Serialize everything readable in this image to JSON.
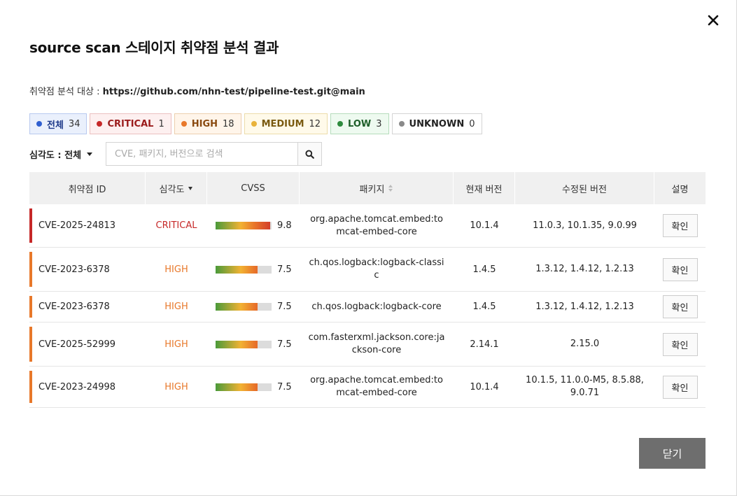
{
  "dialog": {
    "title": "source scan 스테이지 취약점 분석 결과",
    "target_label": "취약점 분석 대상 : ",
    "target_value": "https://github.com/nhn-test/pipeline-test.git@main",
    "close_icon": "close-icon",
    "dismiss_label": "닫기"
  },
  "filters": [
    {
      "label": "전체",
      "count": "34",
      "dot": "#2f5fd0",
      "text": "#1e3a8a",
      "bg": "#eaf0fc",
      "border": "#b8c9ef"
    },
    {
      "label": "CRITICAL",
      "count": "1",
      "dot": "#c62828",
      "text": "#9b1c1c",
      "bg": "#fdf0f0",
      "border": "#ebc0c0"
    },
    {
      "label": "HIGH",
      "count": "18",
      "dot": "#e8782a",
      "text": "#8a4a10",
      "bg": "#fff5ea",
      "border": "#eccfae"
    },
    {
      "label": "MEDIUM",
      "count": "12",
      "dot": "#e8b23a",
      "text": "#7a5a10",
      "bg": "#fffaea",
      "border": "#ecdcaa"
    },
    {
      "label": "LOW",
      "count": "3",
      "dot": "#2e8b3e",
      "text": "#1f5f2a",
      "bg": "#eefaf0",
      "border": "#b6dcbc"
    },
    {
      "label": "UNKNOWN",
      "count": "0",
      "dot": "#8a8a8a",
      "text": "#222222",
      "bg": "#ffffff",
      "border": "#d4d4d4"
    }
  ],
  "severity_filter": {
    "label": "심각도 : 전체"
  },
  "search": {
    "placeholder": "CVE, 패키지, 버전으로 검색",
    "value": "",
    "icon": "search-icon"
  },
  "table": {
    "headers": {
      "id": "취약점 ID",
      "severity": "심각도",
      "cvss": "CVSS",
      "package": "패키지",
      "current": "현재 버전",
      "fixed": "수정된 버전",
      "desc": "설명"
    },
    "rows": [
      {
        "id": "CVE-2025-24813",
        "severity": "CRITICAL",
        "sev_color": "#c62828",
        "cvss": "9.8",
        "cvss_score": 9.8,
        "package": "org.apache.tomcat.embed:tomcat-embed-core",
        "current": "10.1.4",
        "fixed": "11.0.3, 10.1.35, 9.0.99",
        "action": "확인"
      },
      {
        "id": "CVE-2023-6378",
        "severity": "HIGH",
        "sev_color": "#e8782a",
        "cvss": "7.5",
        "cvss_score": 7.5,
        "package": "ch.qos.logback:logback-classic",
        "current": "1.4.5",
        "fixed": "1.3.12, 1.4.12, 1.2.13",
        "action": "확인"
      },
      {
        "id": "CVE-2023-6378",
        "severity": "HIGH",
        "sev_color": "#e8782a",
        "cvss": "7.5",
        "cvss_score": 7.5,
        "package": "ch.qos.logback:logback-core",
        "current": "1.4.5",
        "fixed": "1.3.12, 1.4.12, 1.2.13",
        "action": "확인"
      },
      {
        "id": "CVE-2025-52999",
        "severity": "HIGH",
        "sev_color": "#e8782a",
        "cvss": "7.5",
        "cvss_score": 7.5,
        "package": "com.fasterxml.jackson.core:jackson-core",
        "current": "2.14.1",
        "fixed": "2.15.0",
        "action": "확인"
      },
      {
        "id": "CVE-2023-24998",
        "severity": "HIGH",
        "sev_color": "#e8782a",
        "cvss": "7.5",
        "cvss_score": 7.5,
        "package": "org.apache.tomcat.embed:tomcat-embed-core",
        "current": "10.1.4",
        "fixed": "10.1.5, 11.0.0-M5, 8.5.88, 9.0.71",
        "action": "확인"
      }
    ]
  }
}
